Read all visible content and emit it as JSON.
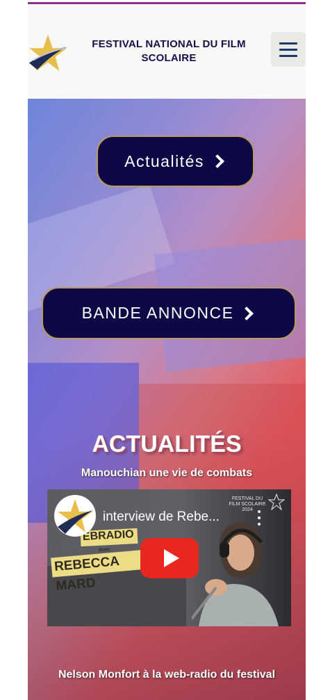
{
  "header": {
    "site_title": "FESTIVAL NATIONAL DU FILM SCOLAIRE",
    "menu_icon": "hamburger-menu-icon",
    "logo_icon": "star-film-logo-icon"
  },
  "hero": {
    "news_button": "Actualités",
    "trailer_button": "BANDE ANNONCE"
  },
  "news": {
    "section_title": "ACTUALITÉS",
    "articles": [
      {
        "title": "Manouchian une vie de combats",
        "video": {
          "title": "interview de Rebe...",
          "channel_brand": "FESTIVAL DU FILM SCOLAIRE 2024",
          "sticker_top": "EBRADIO",
          "sticker_avec": "avec",
          "sticker_name": "REBECCA MARD"
        }
      },
      {
        "title": "Nelson Monfort à la web-radio du festival"
      }
    ]
  },
  "colors": {
    "accent_bar": "#8e2f8f",
    "button_bg": "#0e0847",
    "button_border": "#b99a5e",
    "title_text": "#15124a"
  }
}
